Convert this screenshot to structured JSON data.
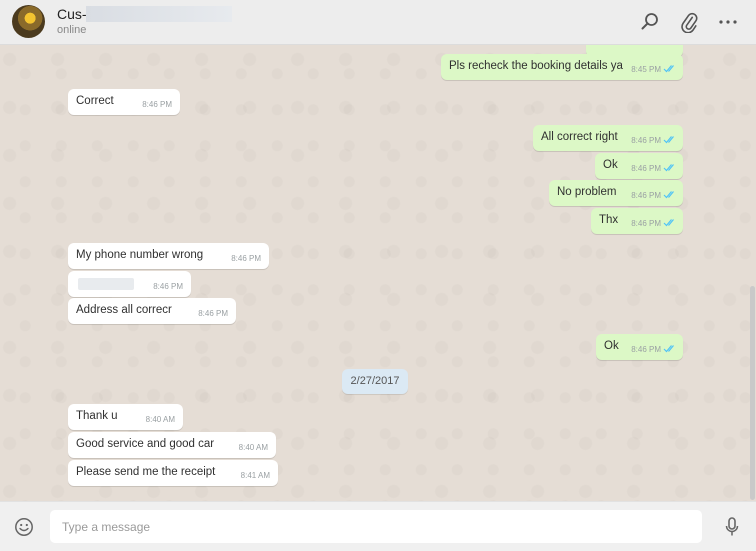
{
  "header": {
    "contact_name": "Cus-",
    "status": "online",
    "icons": [
      "search-icon",
      "attach-icon",
      "menu-icon"
    ]
  },
  "messages": [
    {
      "id": "m0",
      "dir": "out",
      "text": "Pls recheck the booking details ya",
      "time": "8:45 PM"
    },
    {
      "id": "m1",
      "dir": "in",
      "text": "Correct",
      "time": "8:46 PM"
    },
    {
      "id": "m2",
      "dir": "out",
      "text": "All correct right",
      "time": "8:46 PM"
    },
    {
      "id": "m3",
      "dir": "out",
      "text": "Ok",
      "time": "8:46 PM"
    },
    {
      "id": "m4",
      "dir": "out",
      "text": "No problem",
      "time": "8:46 PM"
    },
    {
      "id": "m5",
      "dir": "out",
      "text": "Thx",
      "time": "8:46 PM"
    },
    {
      "id": "m6",
      "dir": "in",
      "text": "My phone number wrong",
      "time": "8:46 PM"
    },
    {
      "id": "m7",
      "dir": "in",
      "text": "",
      "time": "8:46 PM",
      "redacted": true
    },
    {
      "id": "m8",
      "dir": "in",
      "text": "Address all correcr",
      "time": "8:46 PM"
    },
    {
      "id": "m9",
      "dir": "out",
      "text": "Ok",
      "time": "8:46 PM"
    },
    {
      "id": "m10",
      "dir": "in",
      "text": "Thank u",
      "time": "8:40 AM"
    },
    {
      "id": "m11",
      "dir": "in",
      "text": "Good service and good car",
      "time": "8:40 AM"
    },
    {
      "id": "m12",
      "dir": "in",
      "text": "Please send me the receipt",
      "time": "8:41 AM"
    }
  ],
  "date_separator": "2/27/2017",
  "composer": {
    "placeholder": "Type a message",
    "value": ""
  },
  "colors": {
    "outgoing_bubble": "#dcf8c6",
    "incoming_bubble": "#ffffff",
    "read_ticks": "#4fc3f7",
    "chat_background": "#e5ddd5"
  }
}
